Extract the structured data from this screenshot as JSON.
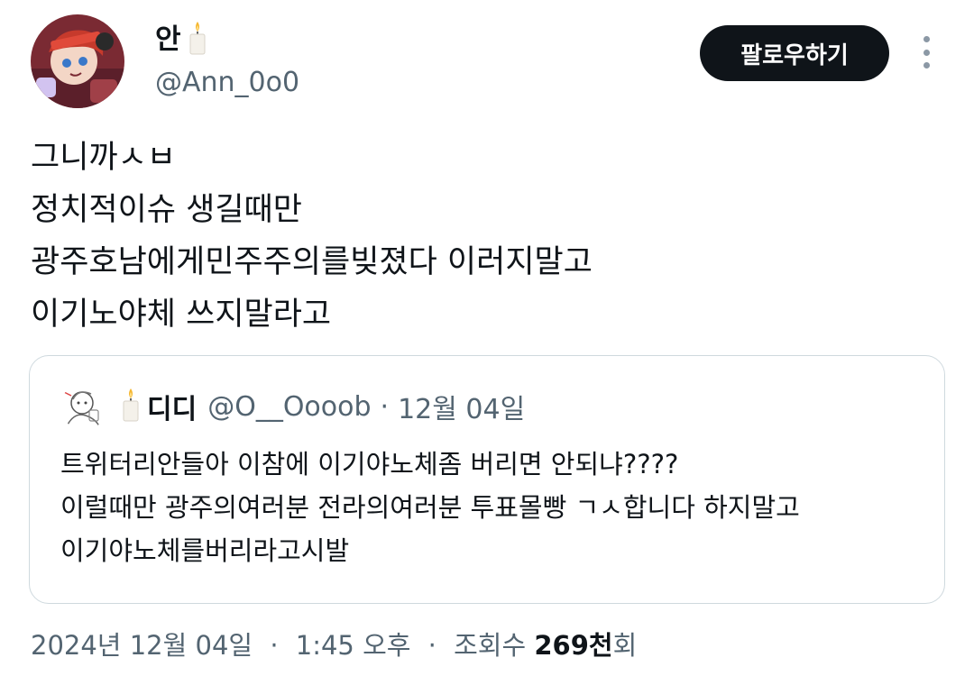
{
  "author": {
    "display_name": "안",
    "name_emoji_icon": "candle-icon",
    "handle": "@Ann_0o0"
  },
  "actions": {
    "follow_label": "팔로우하기",
    "more_icon": "more-vertical-icon"
  },
  "tweet": {
    "lines": [
      "그니까ㅅㅂ",
      "정치적이슈 생길때만",
      "광주호남에게민주주의를빚졌다 이러지말고",
      "이기노야체 쓰지말라고"
    ]
  },
  "quote": {
    "emoji_icon": "candle-icon",
    "display_name": "디디",
    "handle": "@O__Oooob",
    "separator": "·",
    "date": "12월 04일",
    "lines": [
      "트위터리안들아 이참에 이기야노체좀 버리면 안되냐????",
      "이럴때만 광주의여러분 전라의여러분 투표몰빵 ㄱㅅ합니다 하지말고",
      "이기야노체를버리라고시발"
    ]
  },
  "meta": {
    "date": "2024년 12월 04일",
    "separator": "·",
    "time": "1:45 오후",
    "views_label": "조회수",
    "views_count": "269천",
    "views_suffix": "회"
  },
  "colors": {
    "text_primary": "#0f1419",
    "text_secondary": "#536471",
    "border": "#cfd9de",
    "button_bg": "#0f1419"
  }
}
